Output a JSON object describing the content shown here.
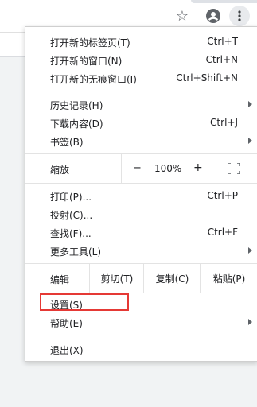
{
  "menu": {
    "new_tab": {
      "label": "打开新的标签页(T)",
      "shortcut": "Ctrl+T"
    },
    "new_window": {
      "label": "打开新的窗口(N)",
      "shortcut": "Ctrl+N"
    },
    "new_incognito": {
      "label": "打开新的无痕窗口(I)",
      "shortcut": "Ctrl+Shift+N"
    },
    "history": {
      "label": "历史记录(H)"
    },
    "downloads": {
      "label": "下载内容(D)",
      "shortcut": "Ctrl+J"
    },
    "bookmarks": {
      "label": "书签(B)"
    },
    "zoom": {
      "label": "缩放",
      "minus": "−",
      "value": "100%",
      "plus": "+"
    },
    "print": {
      "label": "打印(P)...",
      "shortcut": "Ctrl+P"
    },
    "cast": {
      "label": "投射(C)..."
    },
    "find": {
      "label": "查找(F)...",
      "shortcut": "Ctrl+F"
    },
    "more_tools": {
      "label": "更多工具(L)"
    },
    "edit": {
      "label": "编辑",
      "cut": "剪切(T)",
      "copy": "复制(C)",
      "paste": "粘贴(P)"
    },
    "settings": {
      "label": "设置(S)"
    },
    "help": {
      "label": "帮助(E)"
    },
    "exit": {
      "label": "退出(X)"
    }
  },
  "toolbar": {
    "icons": [
      "star-icon",
      "profile-icon",
      "more-vertical-icon"
    ]
  },
  "colors": {
    "highlight": "#e53935",
    "menu_bg": "#ffffff",
    "text": "#202124"
  }
}
